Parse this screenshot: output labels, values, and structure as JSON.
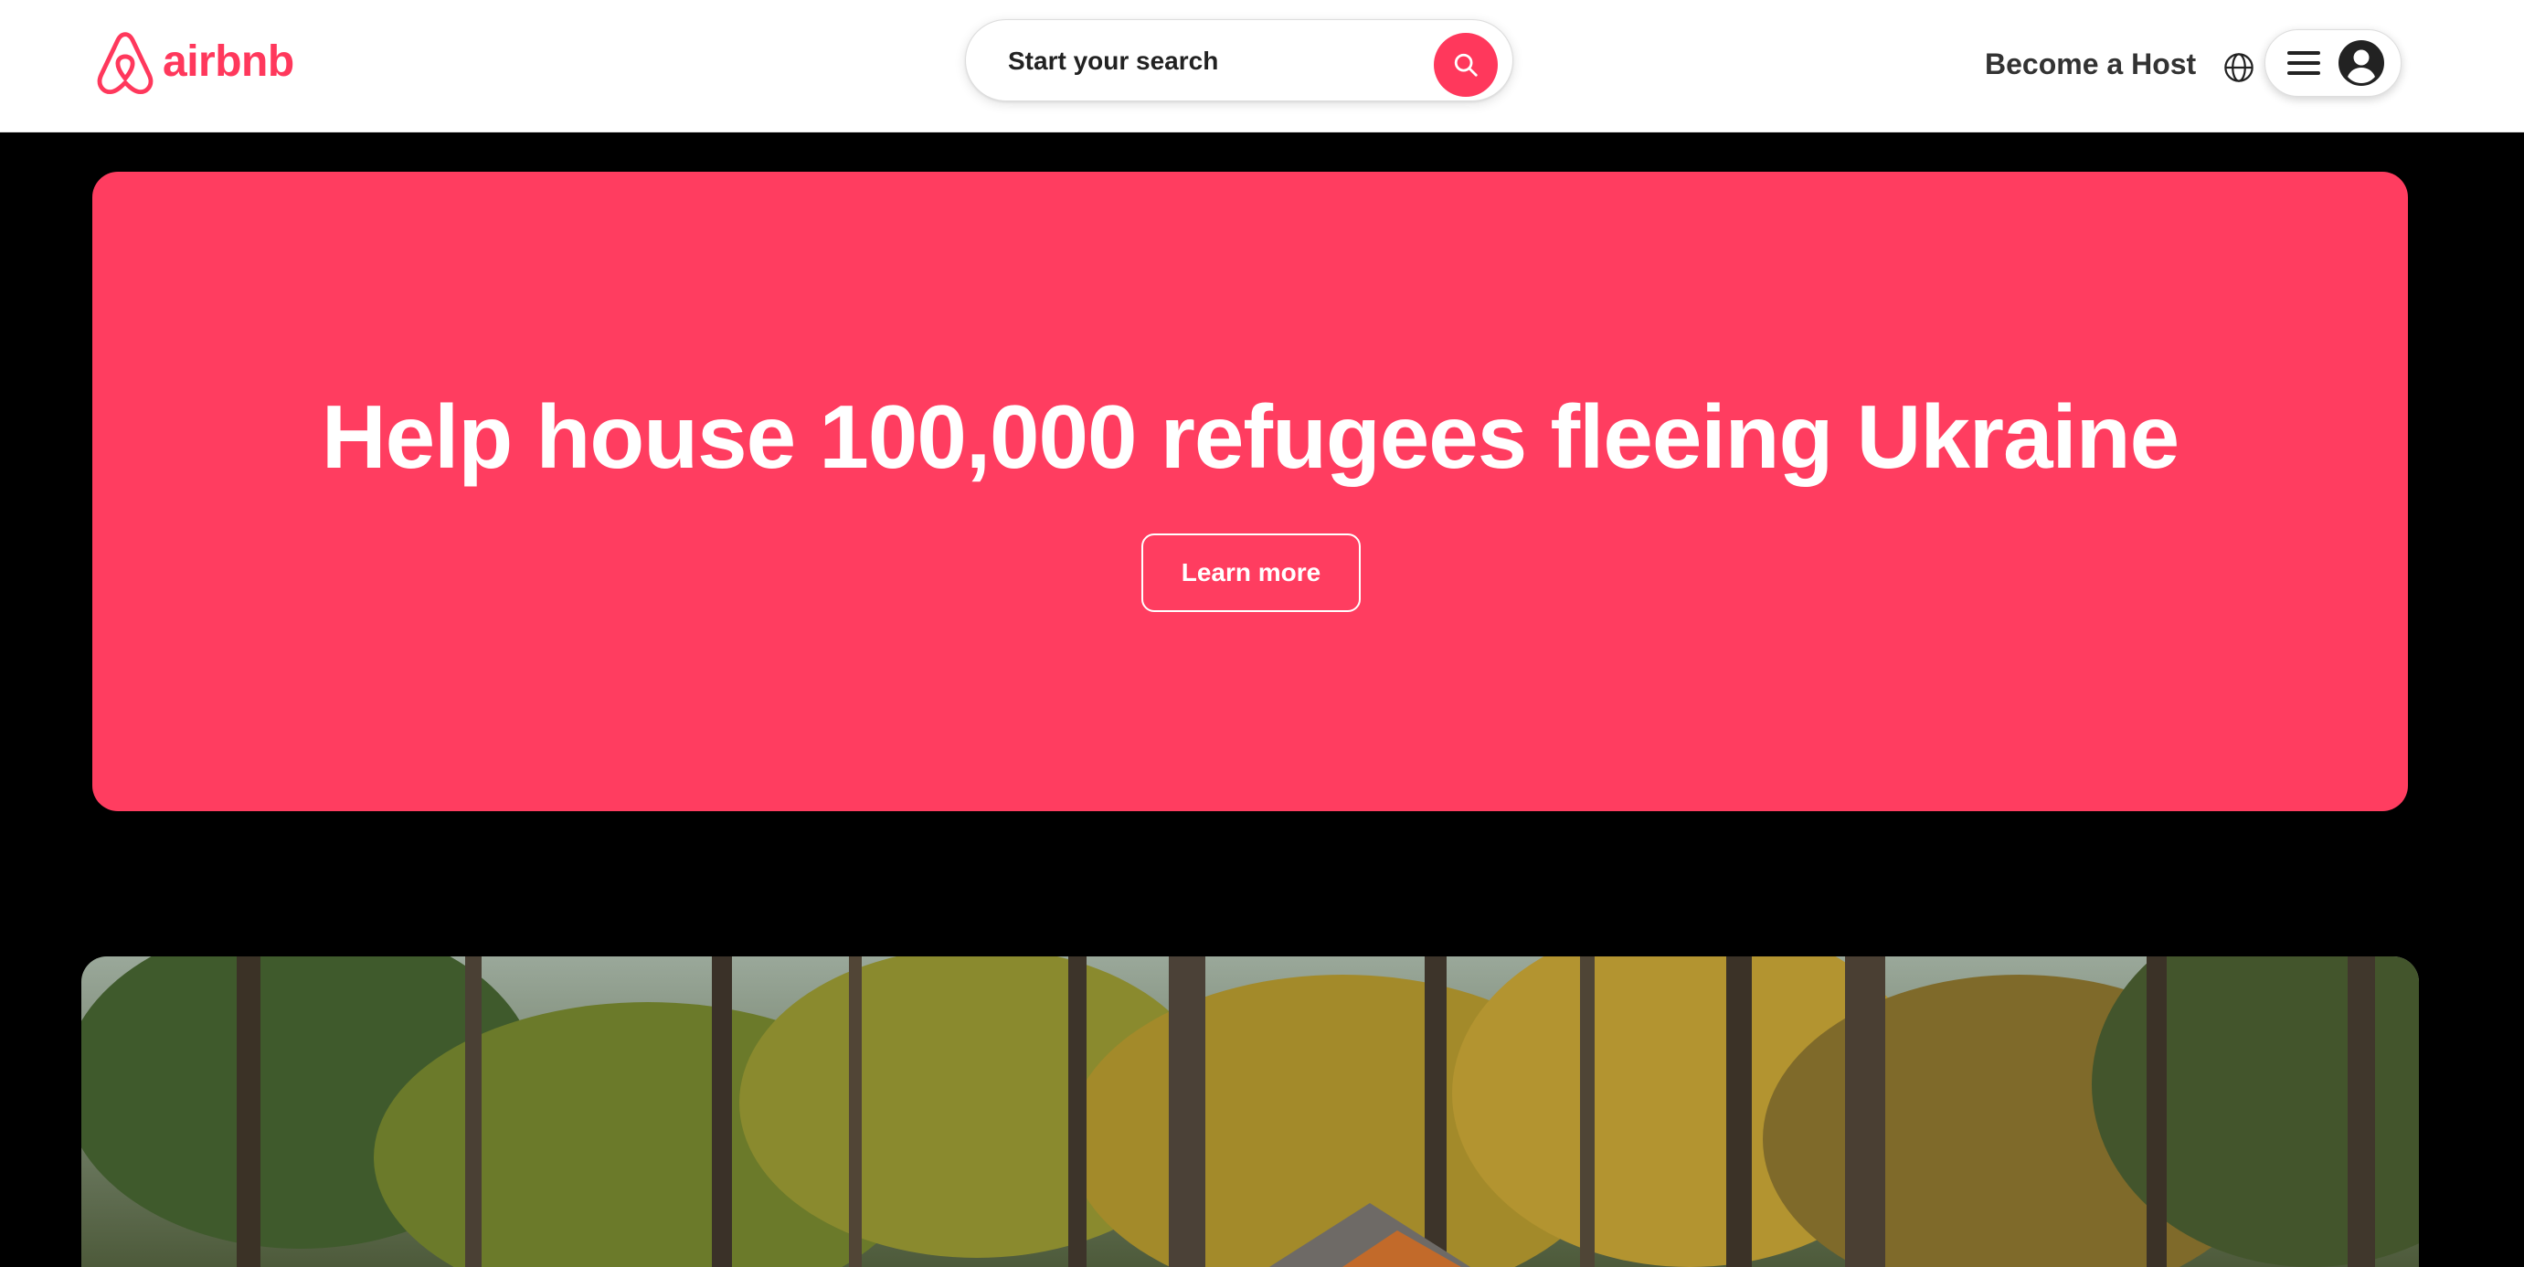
{
  "header": {
    "brand_name": "airbnb",
    "search_label": "Start your search",
    "host_link": "Become a Host",
    "icons": {
      "logo": "airbnb-belo-logo",
      "search": "search-icon",
      "language": "globe-icon",
      "menu": "hamburger-menu-icon",
      "avatar": "user-avatar-icon"
    }
  },
  "banner": {
    "title": "Help house 100,000 refugees fleeing Ukraine",
    "button_label": "Learn more"
  },
  "hero": {
    "image_alt": "A-frame cabin among autumn forest trees"
  },
  "colors": {
    "brand": "#FF385C",
    "banner_bg": "#FF3D60",
    "page_bg": "#000000",
    "header_bg": "#FFFFFF",
    "text_dark": "#222222"
  }
}
